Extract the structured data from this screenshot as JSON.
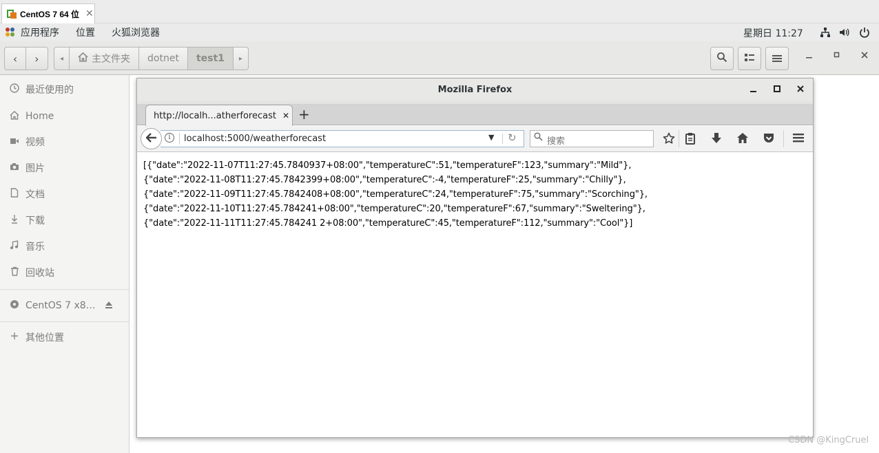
{
  "vm_tab": {
    "title": "CentOS 7 64 位",
    "close": "✕"
  },
  "topbar": {
    "menus": [
      "应用程序",
      "位置",
      "火狐浏览器"
    ],
    "clock": "星期日 11:27"
  },
  "files": {
    "path": [
      "主文件夹",
      "dotnet",
      "test1"
    ],
    "sidebar": [
      {
        "label": "最近使用的",
        "icon": "recent-clock-icon"
      },
      {
        "label": "Home",
        "icon": "home-icon"
      },
      {
        "label": "视频",
        "icon": "video-icon"
      },
      {
        "label": "图片",
        "icon": "camera-icon"
      },
      {
        "label": "文档",
        "icon": "document-icon"
      },
      {
        "label": "下载",
        "icon": "download-icon"
      },
      {
        "label": "音乐",
        "icon": "music-icon"
      },
      {
        "label": "回收站",
        "icon": "trash-icon"
      },
      {
        "label": "CentOS 7 x8…",
        "icon": "disc-icon"
      },
      {
        "label": "其他位置",
        "icon": "plus-icon"
      }
    ]
  },
  "firefox": {
    "window_title": "Mozilla Firefox",
    "tab_title": "http://localh...atherforecast",
    "url": "localhost:5000/weatherforecast",
    "search_placeholder": "搜索",
    "body_lines": [
      "[{\"date\":\"2022-11-07T11:27:45.7840937+08:00\",\"temperatureC\":51,\"temperatureF\":123,\"summary\":\"Mild\"},",
      "{\"date\":\"2022-11-08T11:27:45.7842399+08:00\",\"temperatureC\":-4,\"temperatureF\":25,\"summary\":\"Chilly\"},",
      "{\"date\":\"2022-11-09T11:27:45.7842408+08:00\",\"temperatureC\":24,\"temperatureF\":75,\"summary\":\"Scorching\"},",
      "{\"date\":\"2022-11-10T11:27:45.784241+08:00\",\"temperatureC\":20,\"temperatureF\":67,\"summary\":\"Sweltering\"},",
      "{\"date\":\"2022-11-11T11:27:45.784241 2+08:00\",\"temperatureC\":45,\"temperatureF\":112,\"summary\":\"Cool\"}]"
    ]
  },
  "watermark": "CSDN @KingCruel"
}
